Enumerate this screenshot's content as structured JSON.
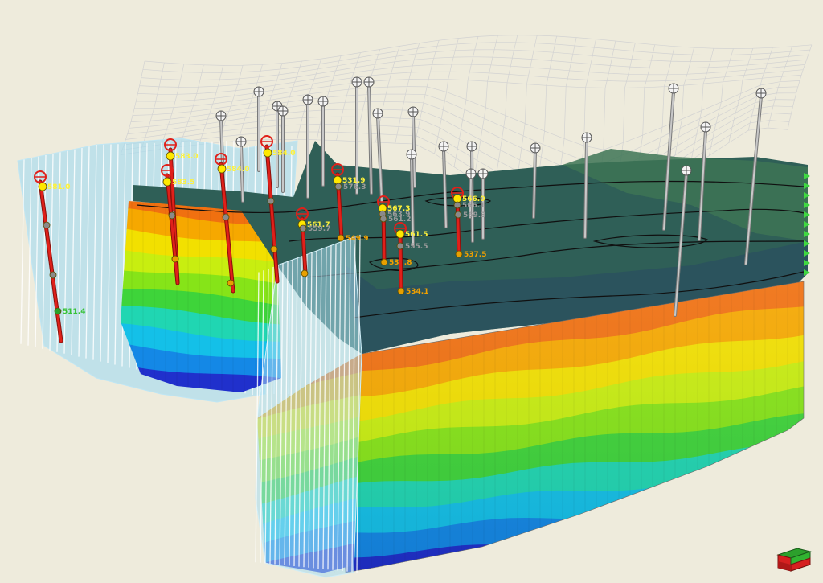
{
  "viewer": {
    "background": "#eeebdc",
    "colors": {
      "well_active": "#e0201a",
      "well_inactive": "#a9a9a9",
      "marker_top": "#ffe800",
      "marker_mid": "#8a8a8a",
      "marker_base": "#e8a000",
      "marker_deep": "#2aa12a",
      "label_yellow": "#fff23a",
      "label_gray": "#9a9a9a",
      "label_orange": "#f0a000",
      "label_green": "#35c235",
      "surface_mesh": "#d2d2d2",
      "top_surface": "#2f5f57",
      "fence": "#9fd6ee"
    },
    "property_ramp": [
      "#f07010",
      "#f6a800",
      "#f2e000",
      "#c8ee10",
      "#86e418",
      "#3ed43a",
      "#20d6b2",
      "#14c0e8",
      "#1488e6",
      "#2030cc"
    ],
    "wells_active": [
      {
        "id": "w1",
        "labels": [
          "581.0",
          "",
          "",
          "511.4"
        ]
      },
      {
        "id": "w2",
        "labels": [
          "583.0",
          "",
          ""
        ]
      },
      {
        "id": "w3",
        "labels": [
          "584.0",
          "",
          ""
        ]
      },
      {
        "id": "w4",
        "labels": [
          "583.5",
          "",
          ""
        ]
      },
      {
        "id": "w5",
        "labels": [
          "584.0",
          "",
          ""
        ]
      },
      {
        "id": "w6",
        "labels": [
          "561.7",
          "559.7",
          ""
        ]
      },
      {
        "id": "w7",
        "labels": [
          "531.9",
          "576.3",
          "549.9"
        ]
      },
      {
        "id": "w8",
        "labels": [
          "567.3",
          "563.9",
          "561.2",
          "537.8"
        ]
      },
      {
        "id": "w9",
        "labels": [
          "561.5",
          "555.5",
          "534.1"
        ]
      },
      {
        "id": "w10",
        "labels": [
          "566.0",
          "566.1",
          "569.3",
          "537.5"
        ]
      }
    ],
    "wells_inactive": [
      {
        "id": "g1"
      },
      {
        "id": "g2"
      },
      {
        "id": "g3"
      },
      {
        "id": "g4"
      },
      {
        "id": "g5"
      },
      {
        "id": "g6"
      },
      {
        "id": "g7"
      },
      {
        "id": "g8"
      },
      {
        "id": "g9"
      },
      {
        "id": "g10"
      },
      {
        "id": "g11"
      },
      {
        "id": "g12"
      },
      {
        "id": "g13"
      },
      {
        "id": "g14"
      },
      {
        "id": "g15"
      },
      {
        "id": "g16"
      },
      {
        "id": "g17"
      },
      {
        "id": "g18"
      },
      {
        "id": "g19"
      },
      {
        "id": "g20"
      },
      {
        "id": "g21"
      },
      {
        "id": "g22"
      }
    ],
    "orientation_cube_icon": "orientation-cube-icon"
  }
}
